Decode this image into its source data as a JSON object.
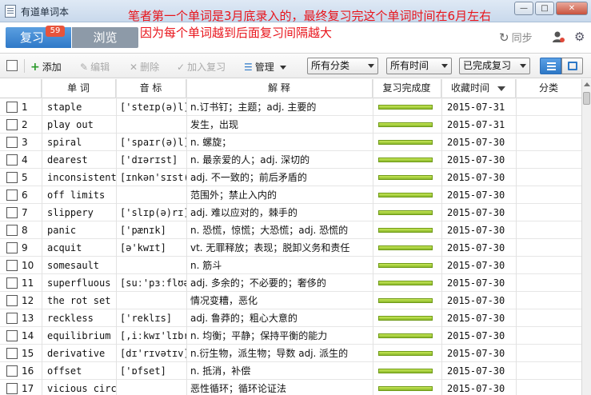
{
  "window": {
    "title": "有道单词本",
    "minimize_glyph": "—",
    "maximize_glyph": "□",
    "close_glyph": "✕"
  },
  "annotations": {
    "line1": "笔者第一个单词是3月底录入的，最终复习完这个单词时间在6月左右",
    "line2": "因为每个单词越到后面复习间隔越大",
    "color": "#e8141b"
  },
  "modes": {
    "review_label": "复习",
    "review_badge": "59",
    "browse_label": "浏览"
  },
  "sync": {
    "label": "同步",
    "icon": "refresh-icon"
  },
  "toolbar": {
    "add": "添加",
    "edit": "编辑",
    "delete": "删除",
    "add_review": "加入复习",
    "manage": "管理",
    "filter_category": "所有分类",
    "filter_time": "所有时间",
    "filter_status": "已完成复习"
  },
  "columns": {
    "word": "单 词",
    "phonetic": "音 标",
    "meaning": "解 释",
    "progress": "复习完成度",
    "date": "收藏时间",
    "category": "分类"
  },
  "accent_color": "#2f79c8",
  "progress_color": "#8ab82a",
  "rows": [
    {
      "n": "1",
      "word": "staple",
      "phonetic": "['steɪp(ə)l]",
      "meaning": "n.订书钉；主题；adj. 主要的",
      "progress": 1.0,
      "date": "2015-07-31"
    },
    {
      "n": "2",
      "word": "play out",
      "phonetic": "",
      "meaning": "发生，出现",
      "progress": 1.0,
      "date": "2015-07-31"
    },
    {
      "n": "3",
      "word": "spiral",
      "phonetic": "['spaɪr(ə)l]",
      "meaning": "n. 螺旋；",
      "progress": 1.0,
      "date": "2015-07-30"
    },
    {
      "n": "4",
      "word": "dearest",
      "phonetic": "['dɪərɪst]",
      "meaning": "n. 最亲爱的人；adj. 深切的",
      "progress": 1.0,
      "date": "2015-07-30"
    },
    {
      "n": "5",
      "word": "inconsistent",
      "phonetic": "[ɪnkən'sɪst(ə)",
      "meaning": "adj. 不一致的；前后矛盾的",
      "progress": 1.0,
      "date": "2015-07-30"
    },
    {
      "n": "6",
      "word": "off limits",
      "phonetic": "",
      "meaning": "范围外；禁止入内的",
      "progress": 1.0,
      "date": "2015-07-30"
    },
    {
      "n": "7",
      "word": "slippery",
      "phonetic": "['slɪp(ə)rɪ]",
      "meaning": "adj. 难以应对的，棘手的",
      "progress": 1.0,
      "date": "2015-07-30"
    },
    {
      "n": "8",
      "word": "panic",
      "phonetic": "['pænɪk]",
      "meaning": "n. 恐慌，惊慌；大恐慌；adj. 恐慌的",
      "progress": 1.0,
      "date": "2015-07-30"
    },
    {
      "n": "9",
      "word": "acquit",
      "phonetic": "[ə'kwɪt]",
      "meaning": "vt. 无罪释放；表现；脱卸义务和责任",
      "progress": 1.0,
      "date": "2015-07-30"
    },
    {
      "n": "10",
      "word": "somesault",
      "phonetic": "",
      "meaning": "n. 筋斗",
      "progress": 1.0,
      "date": "2015-07-30"
    },
    {
      "n": "11",
      "word": "superfluous",
      "phonetic": "[suː'pɜːflʊəs]",
      "meaning": "adj. 多余的；不必要的；奢侈的",
      "progress": 1.0,
      "date": "2015-07-30"
    },
    {
      "n": "12",
      "word": "the rot set",
      "phonetic": "",
      "meaning": "情况变糟，恶化",
      "progress": 1.0,
      "date": "2015-07-30"
    },
    {
      "n": "13",
      "word": "reckless",
      "phonetic": "['reklɪs]",
      "meaning": "adj. 鲁莽的；粗心大意的",
      "progress": 1.0,
      "date": "2015-07-30"
    },
    {
      "n": "14",
      "word": "equilibrium",
      "phonetic": "[,iːkwɪ'lɪbrɪəm",
      "meaning": "n. 均衡；平静；保持平衡的能力",
      "progress": 1.0,
      "date": "2015-07-30"
    },
    {
      "n": "15",
      "word": "derivative",
      "phonetic": "[dɪ'rɪvətɪv]",
      "meaning": "n.衍生物，派生物；导数 adj. 派生的",
      "progress": 1.0,
      "date": "2015-07-30"
    },
    {
      "n": "16",
      "word": "offset",
      "phonetic": "['ɒfset]",
      "meaning": "n. 抵消，补偿",
      "progress": 1.0,
      "date": "2015-07-30"
    },
    {
      "n": "17",
      "word": "vicious circ",
      "phonetic": "",
      "meaning": "恶性循环；循环论证法",
      "progress": 1.0,
      "date": "2015-07-30"
    }
  ]
}
